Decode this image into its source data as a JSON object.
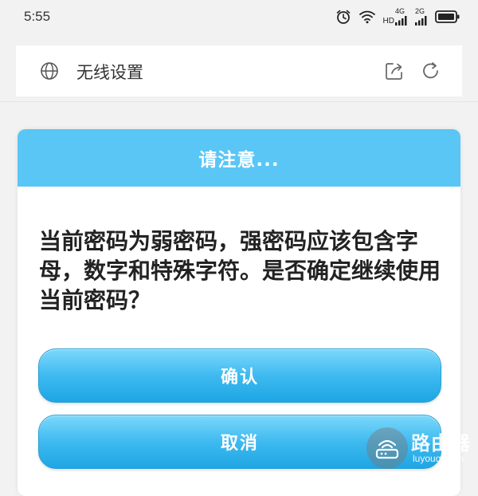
{
  "status_bar": {
    "time": "5:55",
    "network_1": "4G",
    "network_2": "2G",
    "hd_label": "HD"
  },
  "browser": {
    "page_title": "无线设置"
  },
  "dialog": {
    "title": "请注意...",
    "message": "当前密码为弱密码，强密码应该包含字母，数字和特殊字符。是否确定继续使用当前密码？",
    "confirm_label": "确认",
    "cancel_label": "取消"
  },
  "watermark": {
    "name": "路由器",
    "domain": "luyouqi.com"
  },
  "colors": {
    "header": "#59c6f6",
    "button": "#3fbaf0",
    "background": "#f2f2f2"
  }
}
